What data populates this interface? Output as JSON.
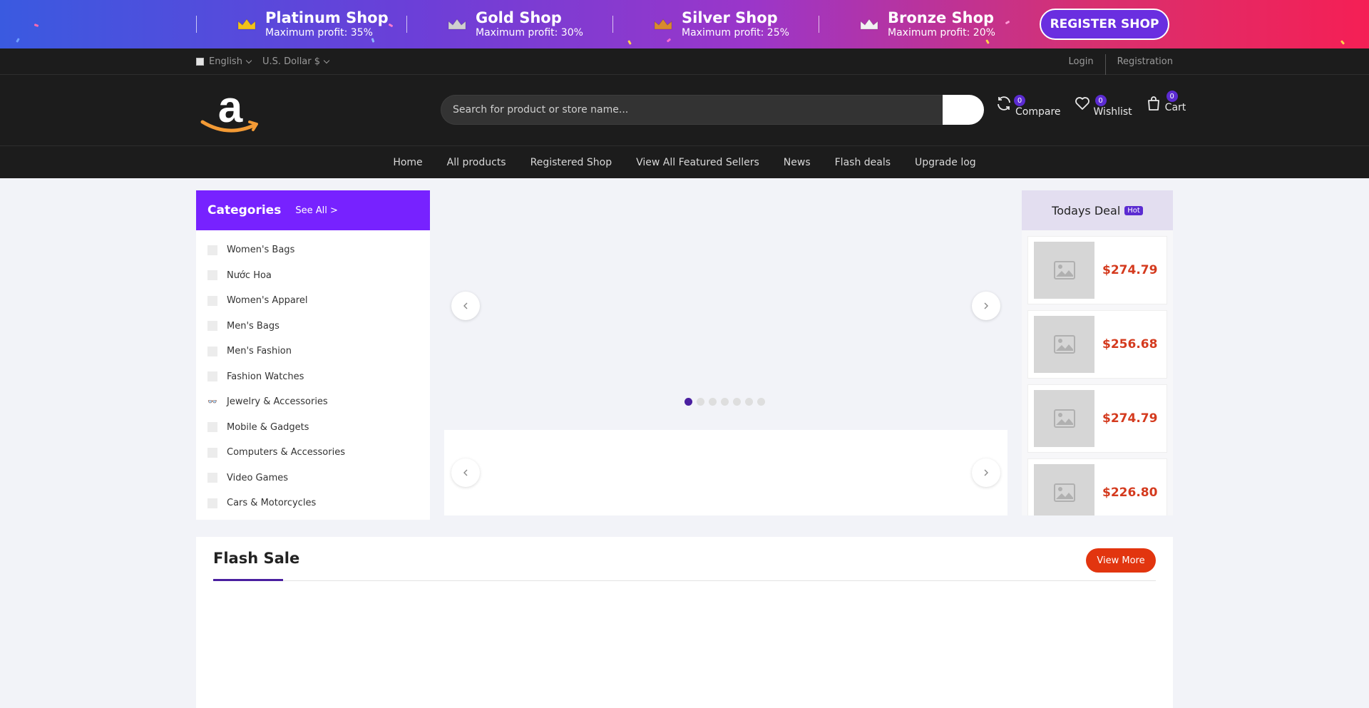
{
  "promo": {
    "tiers": [
      {
        "name": "Platinum Shop",
        "profit": "Maximum profit: 35%",
        "color": "#f3c21a"
      },
      {
        "name": "Gold Shop",
        "profit": "Maximum profit: 30%",
        "color": "#d0d0d0"
      },
      {
        "name": "Silver Shop",
        "profit": "Maximum profit: 25%",
        "color": "#d88a2e"
      },
      {
        "name": "Bronze Shop",
        "profit": "Maximum profit: 20%",
        "color": "#f2f2f2"
      }
    ],
    "register_label": "REGISTER SHOP"
  },
  "utilbar": {
    "language": "English",
    "currency": "U.S. Dollar $",
    "login": "Login",
    "registration": "Registration"
  },
  "header": {
    "search_placeholder": "Search for product or store name...",
    "compare": {
      "label": "Compare",
      "count": "0"
    },
    "wishlist": {
      "label": "Wishlist",
      "count": "0"
    },
    "cart": {
      "label": "Cart",
      "count": "0"
    }
  },
  "nav": [
    "Home",
    "All products",
    "Registered Shop",
    "View All Featured Sellers",
    "News",
    "Flash deals",
    "Upgrade log"
  ],
  "categories": {
    "title": "Categories",
    "see_all": "See All >",
    "items": [
      "Women's Bags",
      "Nước Hoa",
      "Women's Apparel",
      "Men's Bags",
      "Men's Fashion",
      "Fashion Watches",
      "Jewelry & Accessories",
      "Mobile & Gadgets",
      "Computers & Accessories",
      "Video Games",
      "Cars & Motorcycles"
    ]
  },
  "slider": {
    "slide_count": 7,
    "active_index": 0
  },
  "deal": {
    "title": "Todays Deal",
    "badge": "Hot",
    "prices": [
      "$274.79",
      "$256.68",
      "$274.79",
      "$226.80"
    ]
  },
  "flash": {
    "title": "Flash Sale",
    "view_more": "View More"
  },
  "colors": {
    "accent": "#5b2bd1",
    "category_header": "#7722ff",
    "price": "#d43a1e",
    "view_more": "#e2350f"
  }
}
